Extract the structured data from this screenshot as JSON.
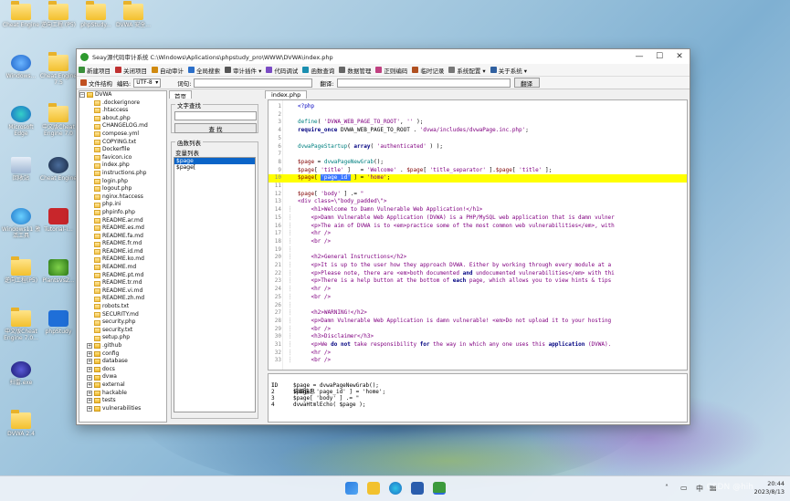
{
  "desktop": {
    "icons": [
      {
        "label": "Cheat Engine",
        "kind": "folder",
        "col": 0,
        "row": 0
      },
      {
        "label": "逆向工程 (P5)",
        "kind": "folder",
        "col": 1,
        "row": 0
      },
      {
        "label": "phpStudy...",
        "kind": "folder",
        "col": 2,
        "row": 0
      },
      {
        "label": "DVWA 安全...",
        "kind": "folder",
        "col": 3,
        "row": 0
      },
      {
        "label": "Windows...",
        "kind": "app-blue",
        "col": 0,
        "row": 1
      },
      {
        "label": "Cheat Engine 7.5",
        "kind": "folder",
        "col": 1,
        "row": 1
      },
      {
        "label": "Microsoft Edge",
        "kind": "edge",
        "col": 0,
        "row": 2
      },
      {
        "label": "中文版Cheat Engine 7.0",
        "kind": "folder",
        "col": 1,
        "row": 2
      },
      {
        "label": "回收站",
        "kind": "bin",
        "col": 0,
        "row": 3
      },
      {
        "label": "Cheat Engine",
        "kind": "ce",
        "col": 1,
        "row": 3
      },
      {
        "label": "Windows11 激活工具",
        "kind": "gear",
        "col": 0,
        "row": 4
      },
      {
        "label": "Tutorial-i...",
        "kind": "red",
        "col": 1,
        "row": 4
      },
      {
        "label": "逆向工程(P5)",
        "kind": "folder",
        "col": 0,
        "row": 5
      },
      {
        "label": "PlantsVsZ...",
        "kind": "plant",
        "col": 1,
        "row": 5
      },
      {
        "label": "中文版Cheat Engine 7.0...",
        "kind": "folder",
        "col": 0,
        "row": 6
      },
      {
        "label": "phpStudy",
        "kind": "pblue",
        "col": 1,
        "row": 6
      },
      {
        "label": "扫雷.exe",
        "kind": "mine",
        "col": 0,
        "row": 7
      },
      {
        "label": "DVWA 2.4",
        "kind": "folder",
        "col": 0,
        "row": 8
      }
    ]
  },
  "window": {
    "title": "Seay源代码审计系统  C:\\Windows\\Aplications\\phpstudy_pro\\WWW\\DVWA\\index.php",
    "menu": [
      {
        "label": "新建项目",
        "color": "#3a8f3a"
      },
      {
        "label": "关闭项目",
        "color": "#c03030"
      },
      {
        "label": "自动审计",
        "color": "#d08a10"
      },
      {
        "label": "全局搜索",
        "color": "#2c6fc9"
      },
      {
        "label": "审计插件 ▾",
        "color": "#555555"
      },
      {
        "label": "代码调试",
        "color": "#7a4bc4"
      },
      {
        "label": "函数查询",
        "color": "#1a8fb0"
      },
      {
        "label": "数据管理",
        "color": "#666666"
      },
      {
        "label": "正则编码",
        "color": "#c04080"
      },
      {
        "label": "临时记录",
        "color": "#b05020"
      },
      {
        "label": "系统配置 ▾",
        "color": "#777777"
      },
      {
        "label": "关于系统 ▾",
        "color": "#3060a0"
      }
    ],
    "toolbar": {
      "structure_label": "文件结构",
      "encoding_label": "编码:",
      "encoding_value": "UTF-8",
      "word_label": "词句:",
      "translate_label": "翻译:",
      "translate_button": "翻译"
    },
    "tree": {
      "root": "DVWA",
      "items": [
        {
          "name": ".dockerignore",
          "type": "file"
        },
        {
          "name": ".htaccess",
          "type": "file"
        },
        {
          "name": "about.php",
          "type": "file"
        },
        {
          "name": "CHANGELOG.md",
          "type": "file"
        },
        {
          "name": "compose.yml",
          "type": "file"
        },
        {
          "name": "COPYING.txt",
          "type": "file"
        },
        {
          "name": "Dockerfile",
          "type": "file"
        },
        {
          "name": "favicon.ico",
          "type": "file"
        },
        {
          "name": "index.php",
          "type": "file"
        },
        {
          "name": "instructions.php",
          "type": "file"
        },
        {
          "name": "login.php",
          "type": "file"
        },
        {
          "name": "logout.php",
          "type": "file"
        },
        {
          "name": "nginx.htaccess",
          "type": "file"
        },
        {
          "name": "php.ini",
          "type": "file"
        },
        {
          "name": "phpinfo.php",
          "type": "file"
        },
        {
          "name": "README.ar.md",
          "type": "file"
        },
        {
          "name": "README.es.md",
          "type": "file"
        },
        {
          "name": "README.fa.md",
          "type": "file"
        },
        {
          "name": "README.fr.md",
          "type": "file"
        },
        {
          "name": "README.id.md",
          "type": "file"
        },
        {
          "name": "README.ko.md",
          "type": "file"
        },
        {
          "name": "README.md",
          "type": "file"
        },
        {
          "name": "README.pt.md",
          "type": "file"
        },
        {
          "name": "README.tr.md",
          "type": "file"
        },
        {
          "name": "README.vi.md",
          "type": "file"
        },
        {
          "name": "README.zh.md",
          "type": "file"
        },
        {
          "name": "robots.txt",
          "type": "file"
        },
        {
          "name": "SECURITY.md",
          "type": "file"
        },
        {
          "name": "security.php",
          "type": "file"
        },
        {
          "name": "security.txt",
          "type": "file"
        },
        {
          "name": "setup.php",
          "type": "file"
        },
        {
          "name": ".github",
          "type": "folder"
        },
        {
          "name": "config",
          "type": "folder"
        },
        {
          "name": "database",
          "type": "folder"
        },
        {
          "name": "docs",
          "type": "folder"
        },
        {
          "name": "dvwa",
          "type": "folder"
        },
        {
          "name": "external",
          "type": "folder"
        },
        {
          "name": "hackable",
          "type": "folder"
        },
        {
          "name": "tests",
          "type": "folder"
        },
        {
          "name": "vulnerabilities",
          "type": "folder"
        }
      ]
    },
    "mid_tabs": [
      "首页",
      "index.php"
    ],
    "search_group_title": "文字查找",
    "search_button": "查 找",
    "func_group_title": "函数列表",
    "var_list_title": "变量列表",
    "var_list": [
      "$page",
      "$page["
    ],
    "editor_lines": [
      {
        "n": "1",
        "html": "<span class='tg'>&lt;?php</span>"
      },
      {
        "n": "2",
        "html": ""
      },
      {
        "n": "3",
        "html": "<span class='fn'>define</span>( <span class='s'>'DVWA_WEB_PAGE_TO_ROOT'</span>, <span class='s'>''</span> );"
      },
      {
        "n": "4",
        "html": "<span class='k'>require_once</span> DVWA_WEB_PAGE_TO_ROOT . <span class='s'>'dvwa/includes/dvwaPage.inc.php'</span>;"
      },
      {
        "n": "5",
        "html": ""
      },
      {
        "n": "6",
        "html": "<span class='fn'>dvwaPageStartup</span>( <span class='k'>array</span>( <span class='s'>'authenticated'</span> ) );"
      },
      {
        "n": "7",
        "html": ""
      },
      {
        "n": "8",
        "html": "<span class='v'>$page</span> = <span class='fn'>dvwaPageNewGrab</span>();"
      },
      {
        "n": "9",
        "html": "<span class='v'>$page</span>[ <span class='s'>'title'</span> ]   = <span class='s'>'Welcome'</span> . <span class='v'>$page</span>[ <span class='s'>'title_separator'</span> ].<span class='v'>$page</span>[ <span class='s'>'title'</span> ];"
      },
      {
        "n": "10",
        "html": "<span class='v'>$page</span>[ <span class='selword'>'page_id'</span> ] = <span class='s'>'home'</span>;",
        "hl": true
      },
      {
        "n": "11",
        "html": ""
      },
      {
        "n": "12",
        "html": "<span class='v'>$page</span>[ <span class='s'>'body'</span> ] .= <span class='s'>\"</span>"
      },
      {
        "n": "13",
        "html": "<span class='s'>&lt;div class=\\\"body_padded\\\"&gt;</span>"
      },
      {
        "n": "14",
        "html": "    <span class='s'>&lt;h1&gt;Welcome to Damn Vulnerable Web Application!&lt;/h1&gt;</span>"
      },
      {
        "n": "15",
        "html": "    <span class='s'>&lt;p&gt;Damn Vulnerable Web Application (DVWA) is a PHP/MySQL web application that is damn vulner</span>"
      },
      {
        "n": "16",
        "html": "    <span class='s'>&lt;p&gt;The aim of DVWA is to &lt;em&gt;practice some of the most common web vulnerabilities&lt;/em&gt;, with</span>"
      },
      {
        "n": "17",
        "html": "    <span class='s'>&lt;hr /&gt;</span>"
      },
      {
        "n": "18",
        "html": "    <span class='s'>&lt;br /&gt;</span>"
      },
      {
        "n": "19",
        "html": ""
      },
      {
        "n": "20",
        "html": "    <span class='s'>&lt;h2&gt;General Instructions&lt;/h2&gt;</span>"
      },
      {
        "n": "21",
        "html": "    <span class='s'>&lt;p&gt;It is up to the user how they approach DVWA. Either by working through every module at a</span>"
      },
      {
        "n": "22",
        "html": "    <span class='s'>&lt;p&gt;Please note, there are &lt;em&gt;both documented </span><span class='k'>and</span><span class='s'> undocumented vulnerabilities&lt;/em&gt; with thi</span>"
      },
      {
        "n": "23",
        "html": "    <span class='s'>&lt;p&gt;There is a help button at the bottom of </span><span class='k'>each</span><span class='s'> page, which allows you to view hints &amp; tips</span>"
      },
      {
        "n": "24",
        "html": "    <span class='s'>&lt;hr /&gt;</span>"
      },
      {
        "n": "25",
        "html": "    <span class='s'>&lt;br /&gt;</span>"
      },
      {
        "n": "26",
        "html": ""
      },
      {
        "n": "27",
        "html": "    <span class='s'>&lt;h2&gt;WARNING!&lt;/h2&gt;</span>"
      },
      {
        "n": "28",
        "html": "    <span class='s'>&lt;p&gt;Damn Vulnerable Web Application is damn vulnerable! &lt;em&gt;Do not upload it to your hosting</span>"
      },
      {
        "n": "29",
        "html": "    <span class='s'>&lt;br /&gt;</span>"
      },
      {
        "n": "30",
        "html": "    <span class='s'>&lt;h3&gt;Disclaimer&lt;/h3&gt;</span>"
      },
      {
        "n": "31",
        "html": "    <span class='s'>&lt;p&gt;We </span><span class='k'>do not</span><span class='s'> take responsibility </span><span class='k'>for</span><span class='s'> the way in which any one uses this </span><span class='k'>application</span><span class='s'> (DVWA).</span>"
      },
      {
        "n": "32",
        "html": "    <span class='s'>&lt;hr /&gt;</span>"
      },
      {
        "n": "33",
        "html": "    <span class='s'>&lt;br /&gt;</span>"
      }
    ],
    "detail": {
      "header_id": "ID",
      "header_info": "详细信息",
      "rows": [
        {
          "id": "1",
          "info": "$page = dvwaPageNewGrab();"
        },
        {
          "id": "2",
          "info": "$page[ 'page_id' ] = 'home';"
        },
        {
          "id": "3",
          "info": "$page[ 'body' ] .= \""
        },
        {
          "id": "4",
          "info": "dvwaHtmlEcho( $page );"
        }
      ]
    }
  },
  "taskbar": {
    "tray_lang": "中",
    "time": "20:44",
    "date": "2023/8/13",
    "watermark": "CSDN @hih"
  }
}
